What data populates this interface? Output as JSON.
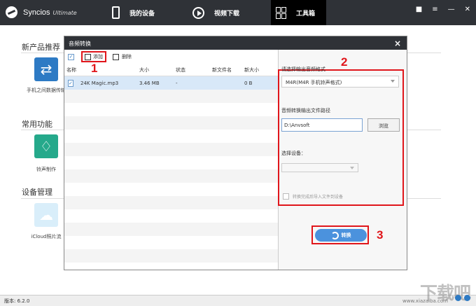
{
  "app": {
    "brand": "Syncios",
    "brand_sub": "Ultimate",
    "tabs": [
      "我的设备",
      "视频下载",
      "工具箱"
    ],
    "window_controls": [
      "■",
      "≡",
      "—",
      "✕"
    ],
    "version": "版本: 6.2.0",
    "watermark": "下载吧",
    "watermark_url": "www.xiazaiba.com"
  },
  "background": {
    "sections": [
      {
        "title": "新产品推荐",
        "tile": {
          "label": "手机之间数据传输",
          "icon": "transfer-icon",
          "color": "#2d7ac4"
        }
      },
      {
        "title": "常用功能",
        "tile": {
          "label": "铃声制作",
          "icon": "bell-icon",
          "color": "#25a98b"
        }
      },
      {
        "title": "设备管理",
        "tile": {
          "label": "iCloud照片流",
          "icon": "cloud-icon",
          "color": "#d9eefa"
        }
      }
    ]
  },
  "dialog": {
    "title": "音频转换",
    "toolbar": {
      "add": "添加",
      "delete": "删除"
    },
    "table": {
      "headers": [
        "名称",
        "大小",
        "状态",
        "新文件名",
        "新大小"
      ],
      "rows": [
        {
          "name": "24K Magic.mp3",
          "size": "3.46 MB",
          "status": "-",
          "new_name": "",
          "new_size": "0 B",
          "checked": true
        }
      ]
    },
    "output_format_label": "请选择输出音频格式",
    "output_format_value": "M4R(M4R 手机铃声格式)",
    "output_path_label": "音频转换输出文件路径",
    "output_path_value": "D:\\Anvsoft",
    "browse_label": "浏览",
    "device_label": "选择设备：",
    "device_value": "",
    "import_label": "转换完成后导入文件到设备",
    "convert_label": "转换"
  },
  "annotations": [
    "1",
    "2",
    "3"
  ]
}
